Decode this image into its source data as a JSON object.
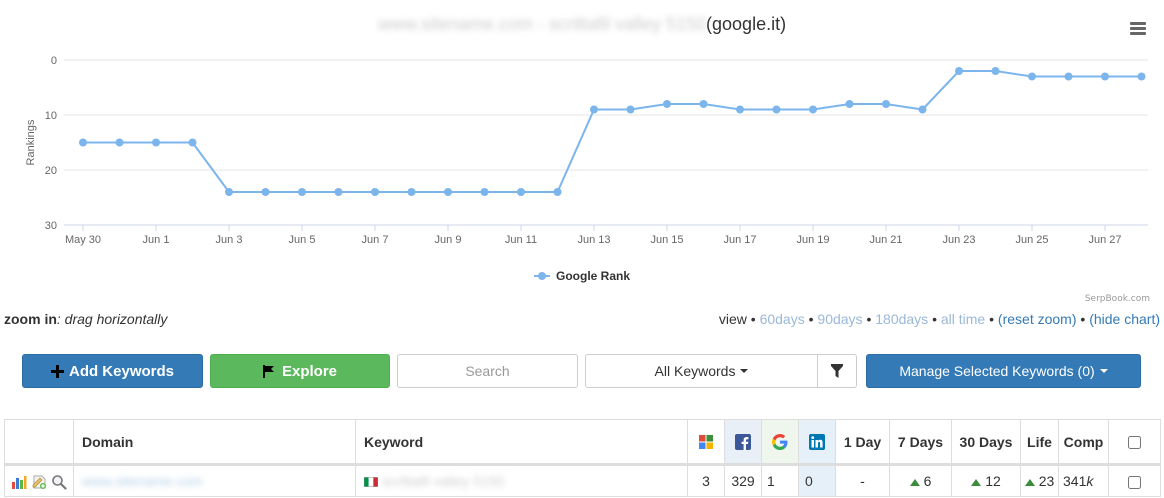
{
  "chart_title": {
    "site": "www.sitename.com - scrittafil valley 5150",
    "engine": "(google.it)"
  },
  "chart_credit": "SerpBook.com",
  "chart_data": {
    "type": "line",
    "ylabel": "Rankings",
    "y_reversed": true,
    "ylim": [
      0,
      30
    ],
    "y_ticks": [
      0,
      10,
      20,
      30
    ],
    "grid": true,
    "legend_position": "bottom-center",
    "x_tick_labels": [
      "May 30",
      "Jun 1",
      "Jun 3",
      "Jun 5",
      "Jun 7",
      "Jun 9",
      "Jun 11",
      "Jun 13",
      "Jun 15",
      "Jun 17",
      "Jun 19",
      "Jun 21",
      "Jun 23",
      "Jun 25",
      "Jun 27"
    ],
    "series": [
      {
        "name": "Google Rank",
        "color": "#7cb5ec",
        "x": [
          "May 30",
          "May 31",
          "Jun 1",
          "Jun 2",
          "Jun 3",
          "Jun 4",
          "Jun 5",
          "Jun 6",
          "Jun 7",
          "Jun 8",
          "Jun 9",
          "Jun 10",
          "Jun 11",
          "Jun 12",
          "Jun 13",
          "Jun 14",
          "Jun 15",
          "Jun 16",
          "Jun 17",
          "Jun 18",
          "Jun 19",
          "Jun 20",
          "Jun 21",
          "Jun 22",
          "Jun 23",
          "Jun 24",
          "Jun 25",
          "Jun 26",
          "Jun 27",
          "Jun 28"
        ],
        "values": [
          15,
          15,
          15,
          15,
          24,
          24,
          24,
          24,
          24,
          24,
          24,
          24,
          24,
          24,
          9,
          9,
          8,
          8,
          9,
          9,
          9,
          8,
          8,
          9,
          2,
          2,
          3,
          3,
          3,
          3
        ]
      }
    ]
  },
  "zoom_hint": {
    "label": "zoom in",
    "text": ": drag horizontally"
  },
  "view": {
    "label": "view",
    "sep": " • ",
    "options": [
      "60days",
      "90days",
      "180days",
      "all time"
    ],
    "reset_zoom": "(reset zoom)",
    "hide_chart": "(hide chart)"
  },
  "toolbar": {
    "add_keywords": "Add Keywords",
    "explore": "Explore",
    "search_placeholder": "Search",
    "all_keywords": "All Keywords",
    "manage": "Manage Selected Keywords (0)"
  },
  "table": {
    "headers": {
      "domain": "Domain",
      "keyword": "Keyword",
      "day1": "1 Day",
      "day7": "7 Days",
      "day30": "30 Days",
      "life": "Life",
      "comp": "Comp"
    },
    "rows": [
      {
        "domain": "www.sitename.com",
        "keyword": "scrittafil valley 5150",
        "gplus": "3",
        "facebook": "329",
        "google": "1",
        "linkedin": "0",
        "day1": "-",
        "day7": "6",
        "day30": "12",
        "life": "23",
        "comp": "341",
        "comp_suffix": "k"
      }
    ]
  }
}
